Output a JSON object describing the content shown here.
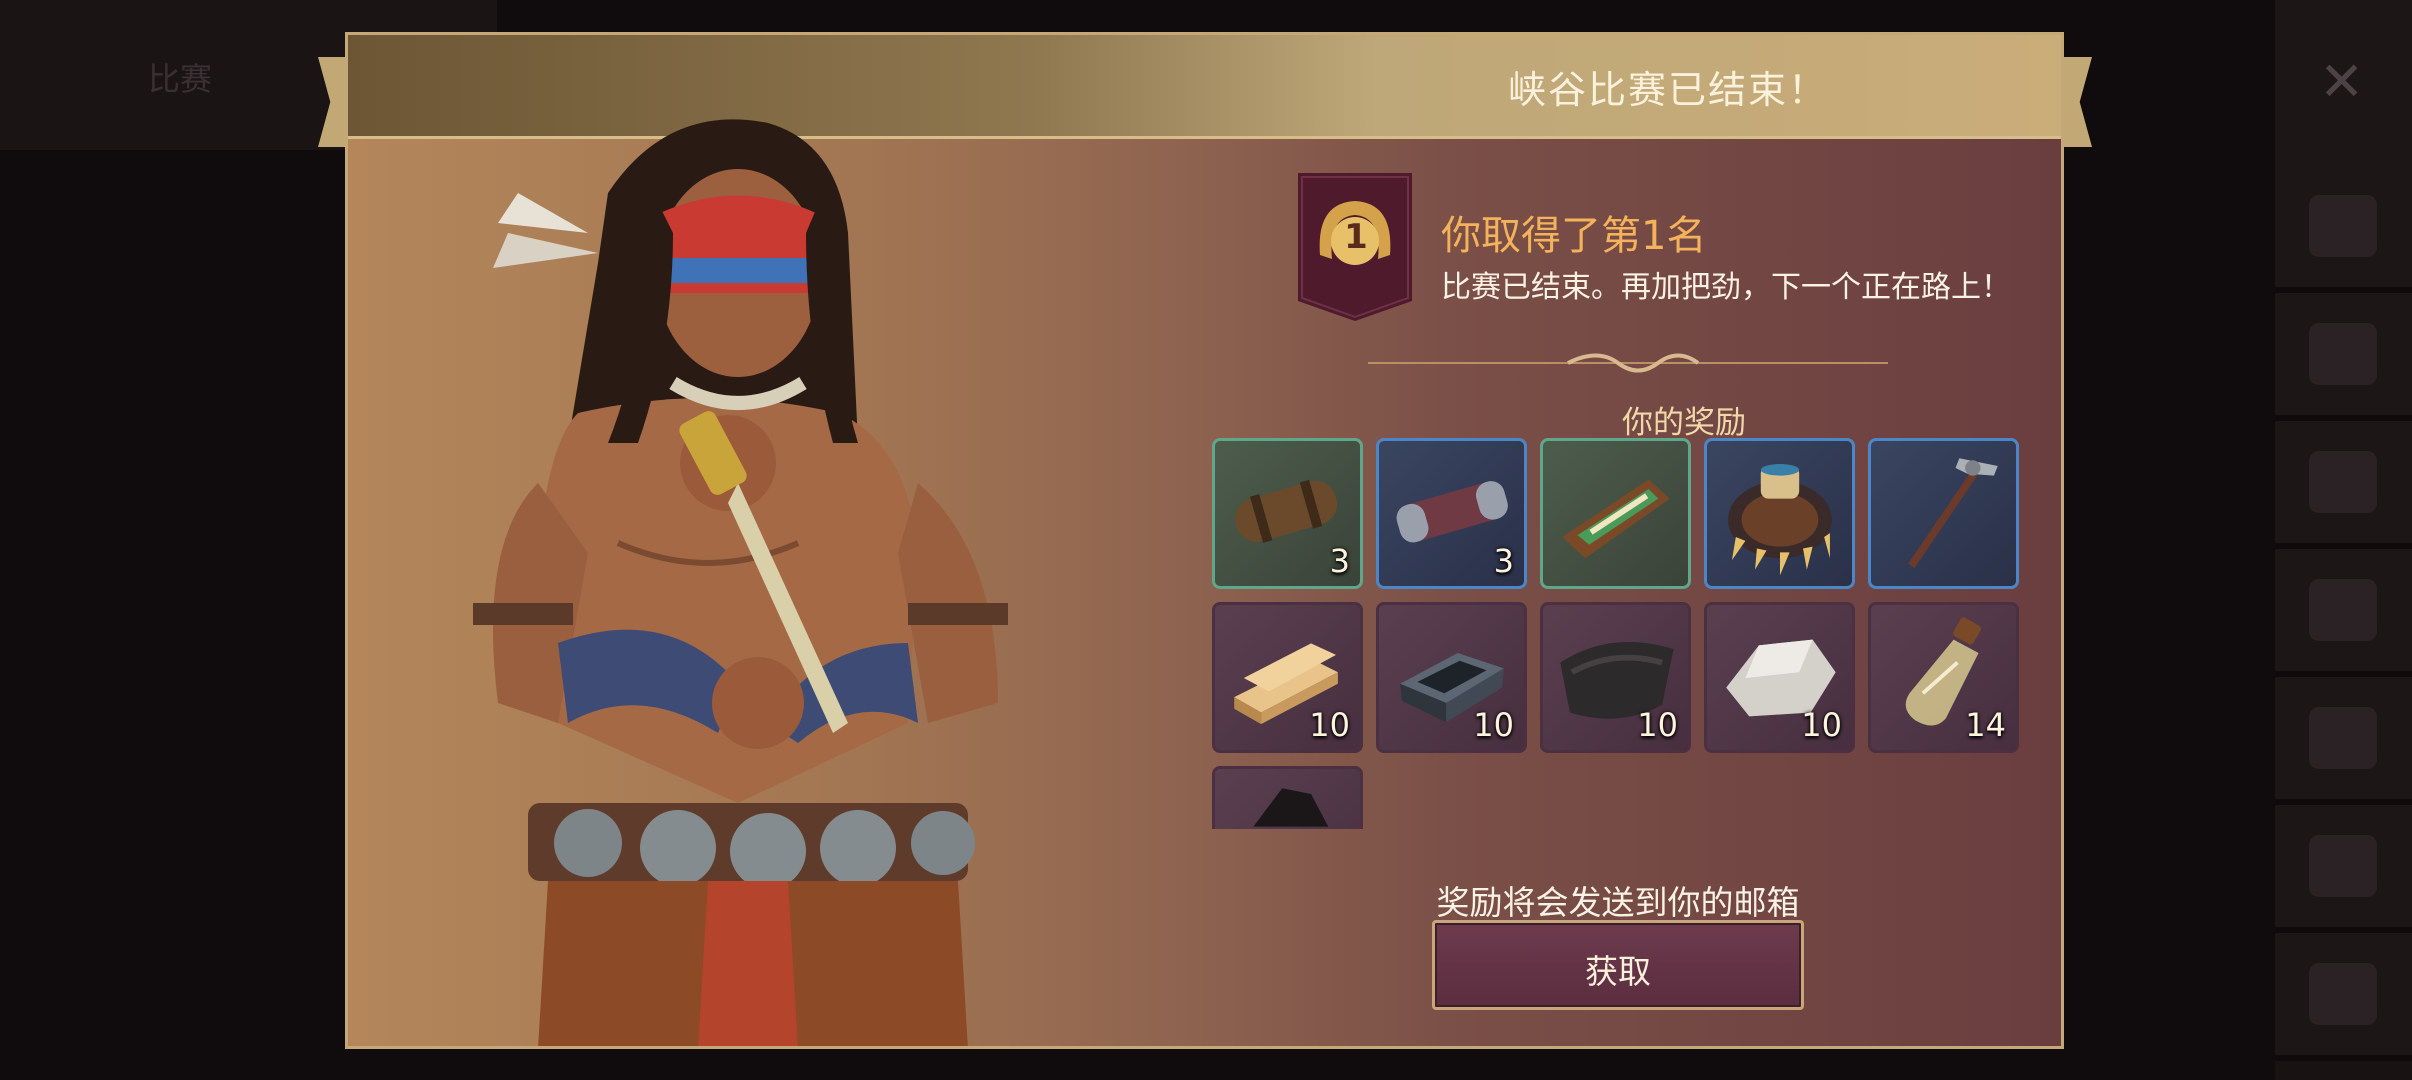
{
  "background": {
    "tab_label": "比赛",
    "close_glyph": "✕",
    "sidebar_icons": [
      "ranking-icon",
      "character-icon",
      "building-icon",
      "book-icon",
      "coin-icon",
      "hat-icon",
      "bag-icon"
    ]
  },
  "modal": {
    "title": "峡谷比赛已结束！",
    "badge_rank": "1",
    "placement_title": "你取得了第1名",
    "placement_subtitle": "比赛已结束。再加把劲，下一个正在路上！",
    "rewards_title": "你的奖励",
    "rewards": [
      {
        "icon": "leather-case-icon",
        "quantity": "3",
        "rarity": "green"
      },
      {
        "icon": "metal-tube-icon",
        "quantity": "3",
        "rarity": "blue"
      },
      {
        "icon": "beaded-pouch-icon",
        "quantity": "",
        "rarity": "green"
      },
      {
        "icon": "claw-necklace-icon",
        "quantity": "",
        "rarity": "blue"
      },
      {
        "icon": "tomahawk-icon",
        "quantity": "",
        "rarity": "blue"
      },
      {
        "icon": "wood-planks-icon",
        "quantity": "10",
        "rarity": "common"
      },
      {
        "icon": "iron-ingot-icon",
        "quantity": "10",
        "rarity": "common"
      },
      {
        "icon": "leather-icon",
        "quantity": "10",
        "rarity": "common"
      },
      {
        "icon": "stone-icon",
        "quantity": "10",
        "rarity": "common"
      },
      {
        "icon": "oil-bottle-icon",
        "quantity": "14",
        "rarity": "common"
      },
      {
        "icon": "coal-icon",
        "quantity": "",
        "rarity": "common"
      }
    ],
    "mail_note": "奖励将会发送到你的邮箱",
    "claim_label": "获取"
  },
  "colors": {
    "accent_gold": "#f3b25b",
    "frame_gold": "#c4a878",
    "button_fill": "#5a2d3f",
    "badge_fill": "#4e1a2c"
  }
}
